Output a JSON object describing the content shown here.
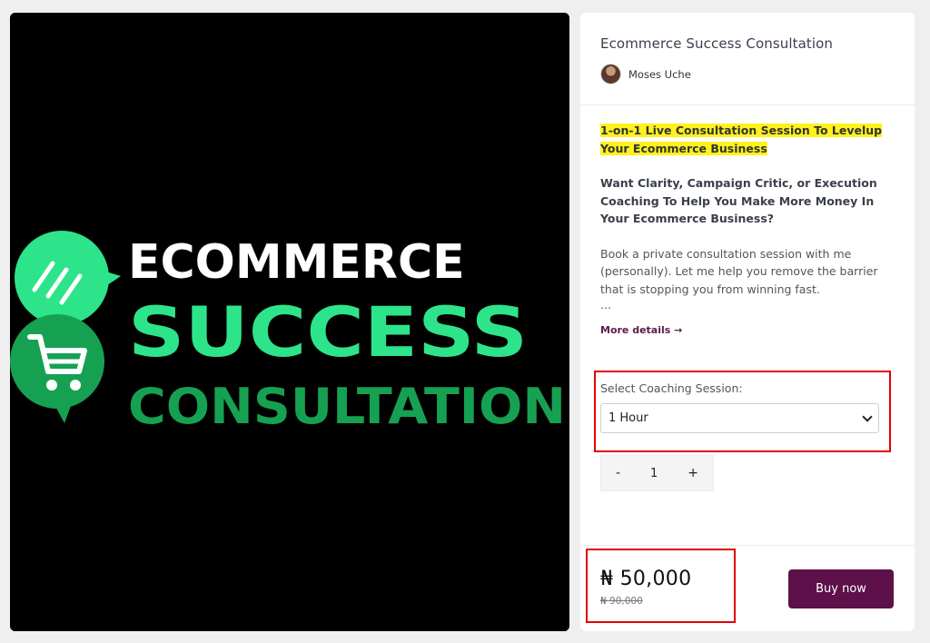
{
  "hero": {
    "line1": "ECOMMERCE",
    "line2": "SUCCESS",
    "line3": "CONSULTATION",
    "colors": {
      "background": "#000000",
      "bright_green": "#2ee48a",
      "dark_green": "#16a152",
      "white": "#ffffff"
    },
    "icons": [
      "speech-bubble-icon",
      "shopping-cart-icon"
    ]
  },
  "product": {
    "title": "Ecommerce Success Consultation",
    "seller": "Moses Uche"
  },
  "description": {
    "highlight": "1-on-1 Live Consultation Session To Levelup Your Ecommerce Business ",
    "subheading": "Want Clarity, Campaign Critic, or Execution Coaching To Help You Make More Money In Your Ecommerce Business?",
    "body": "Book a private consultation session with me (personally). Let me help you remove the barrier that is stopping you from winning fast.",
    "ellipsis": "...",
    "more_link": "More details →"
  },
  "session": {
    "label": "Select Coaching Session:",
    "selected": "1 Hour"
  },
  "quantity": {
    "minus": "-",
    "value": "1",
    "plus": "+"
  },
  "pricing": {
    "price": "₦ 50,000",
    "old_price": "₦ 90,000",
    "buy_label": "Buy now",
    "accent_color": "#5d1049",
    "annotation_color": "#e00000"
  }
}
